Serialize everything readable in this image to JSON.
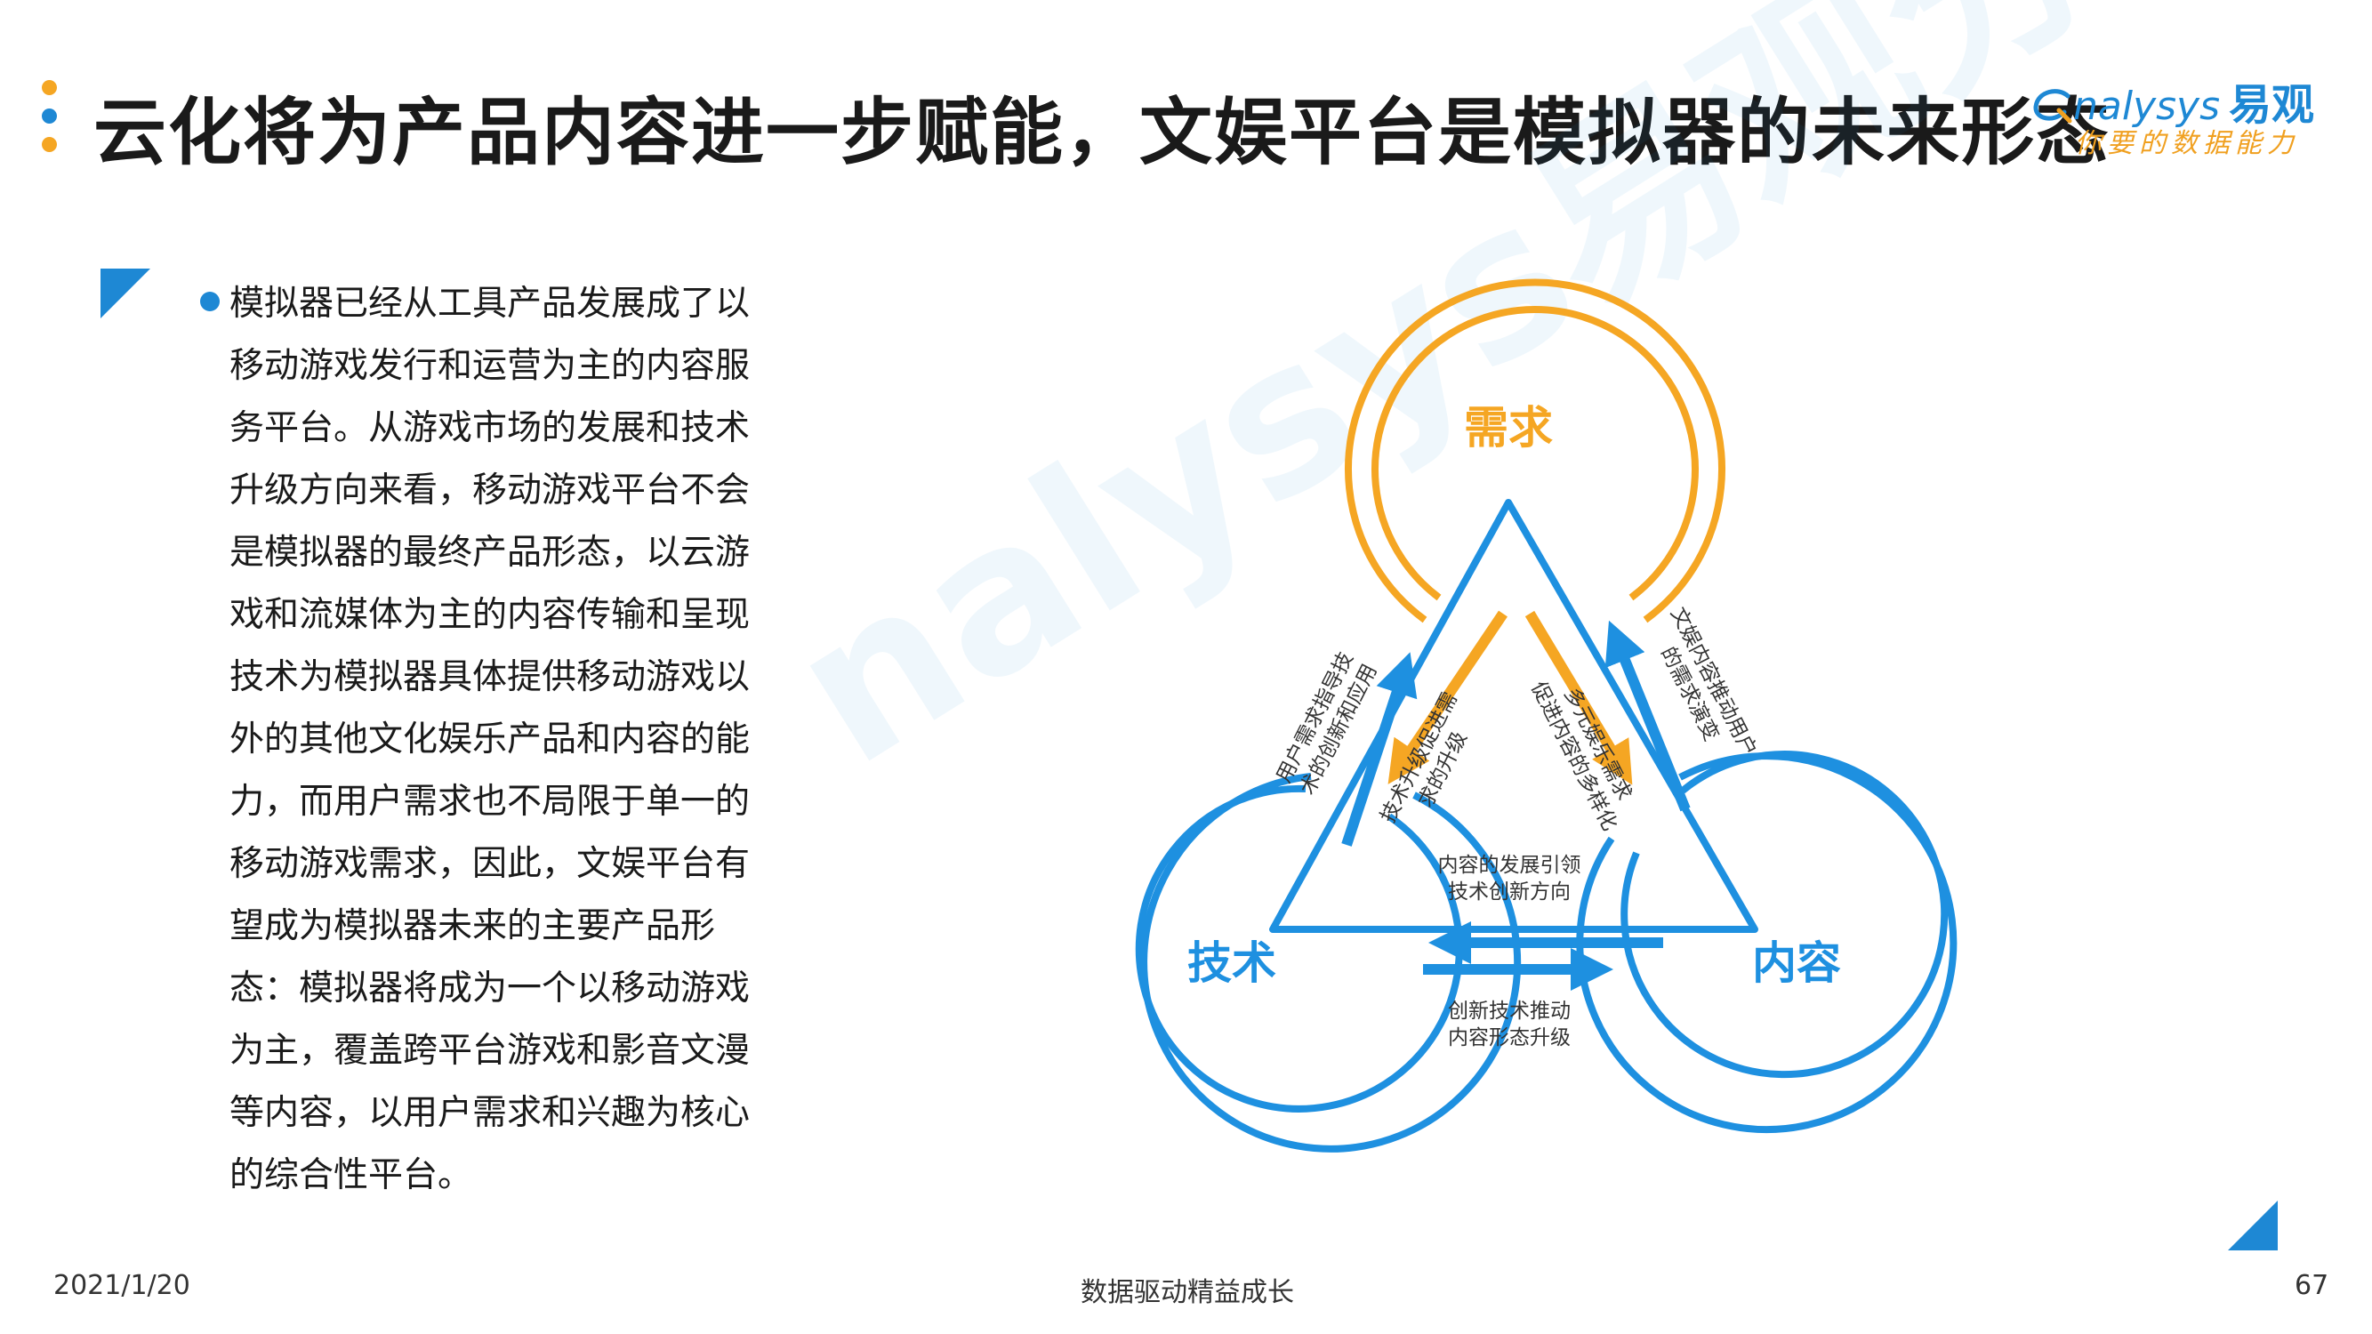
{
  "header": {
    "title": "云化将为产品内容进一步赋能，文娱平台是模拟器的未来形态",
    "dot_colors": [
      "#f5a623",
      "#1e88d4",
      "#f5a623"
    ]
  },
  "logo": {
    "wordmark": "nalysys",
    "chinese": "易观",
    "slogan": "你要的数据能力"
  },
  "body": {
    "paragraph": "模拟器已经从工具产品发展成了以移动游戏发行和运营为主的内容服务平台。从游戏市场的发展和技术升级方向来看，移动游戏平台不会是模拟器的最终产品形态，以云游戏和流媒体为主的内容传输和呈现技术为模拟器具体提供移动游戏以外的其他文化娱乐产品和内容的能力，而用户需求也不局限于单一的移动游戏需求，因此，文娱平台有望成为模拟器未来的主要产品形态：模拟器将成为一个以移动游戏为主，覆盖跨平台游戏和影音文漫等内容，以用户需求和兴趣为核心的综合性平台。"
  },
  "diagram": {
    "nodes": {
      "top": "需求",
      "left": "技术",
      "right": "内容"
    },
    "labels": {
      "demand_to_tech": [
        "用户需求指导技",
        "术的创新和应用"
      ],
      "tech_to_demand": [
        "技术升级促进需",
        "求的升级"
      ],
      "demand_to_content": [
        "多元娱乐需求",
        "促进内容的多样化"
      ],
      "content_to_demand": [
        "文娱内容推动用户",
        "的需求演变"
      ],
      "content_to_tech": [
        "内容的发展引领",
        "技术创新方向"
      ],
      "tech_to_content": [
        "创新技术推动",
        "内容形态升级"
      ]
    },
    "colors": {
      "orange": "#f5a623",
      "blue": "#1e90e0"
    }
  },
  "watermark": "nalysys易观分析",
  "footer": {
    "date": "2021/1/20",
    "slogan": "数据驱动精益成长",
    "page": "67"
  }
}
